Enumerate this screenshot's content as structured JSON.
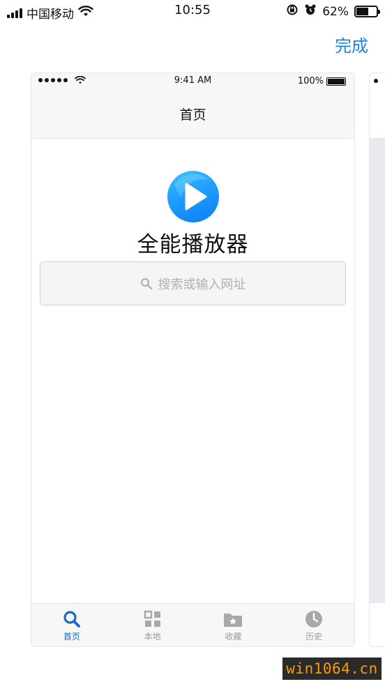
{
  "status_bar": {
    "carrier": "中国移动",
    "time": "10:55",
    "battery_percent": "62%",
    "battery_level": 0.62
  },
  "switcher": {
    "done_label": "完成",
    "accent_color": "#1a86e8"
  },
  "card": {
    "status": {
      "time": "9:41 AM",
      "battery_percent": "100%"
    },
    "nav_title": "首页",
    "app_name": "全能播放器",
    "search": {
      "placeholder": "搜索或输入网址"
    },
    "tabs": [
      {
        "label": "首页",
        "icon": "search-icon",
        "active": true
      },
      {
        "label": "本地",
        "icon": "grid-icon",
        "active": false
      },
      {
        "label": "收藏",
        "icon": "folder-star-icon",
        "active": false
      },
      {
        "label": "历史",
        "icon": "clock-icon",
        "active": false
      }
    ],
    "active_tab_color": "#1b66c9",
    "logo_color": "#1f9dff"
  },
  "watermark": "win1064.cn"
}
